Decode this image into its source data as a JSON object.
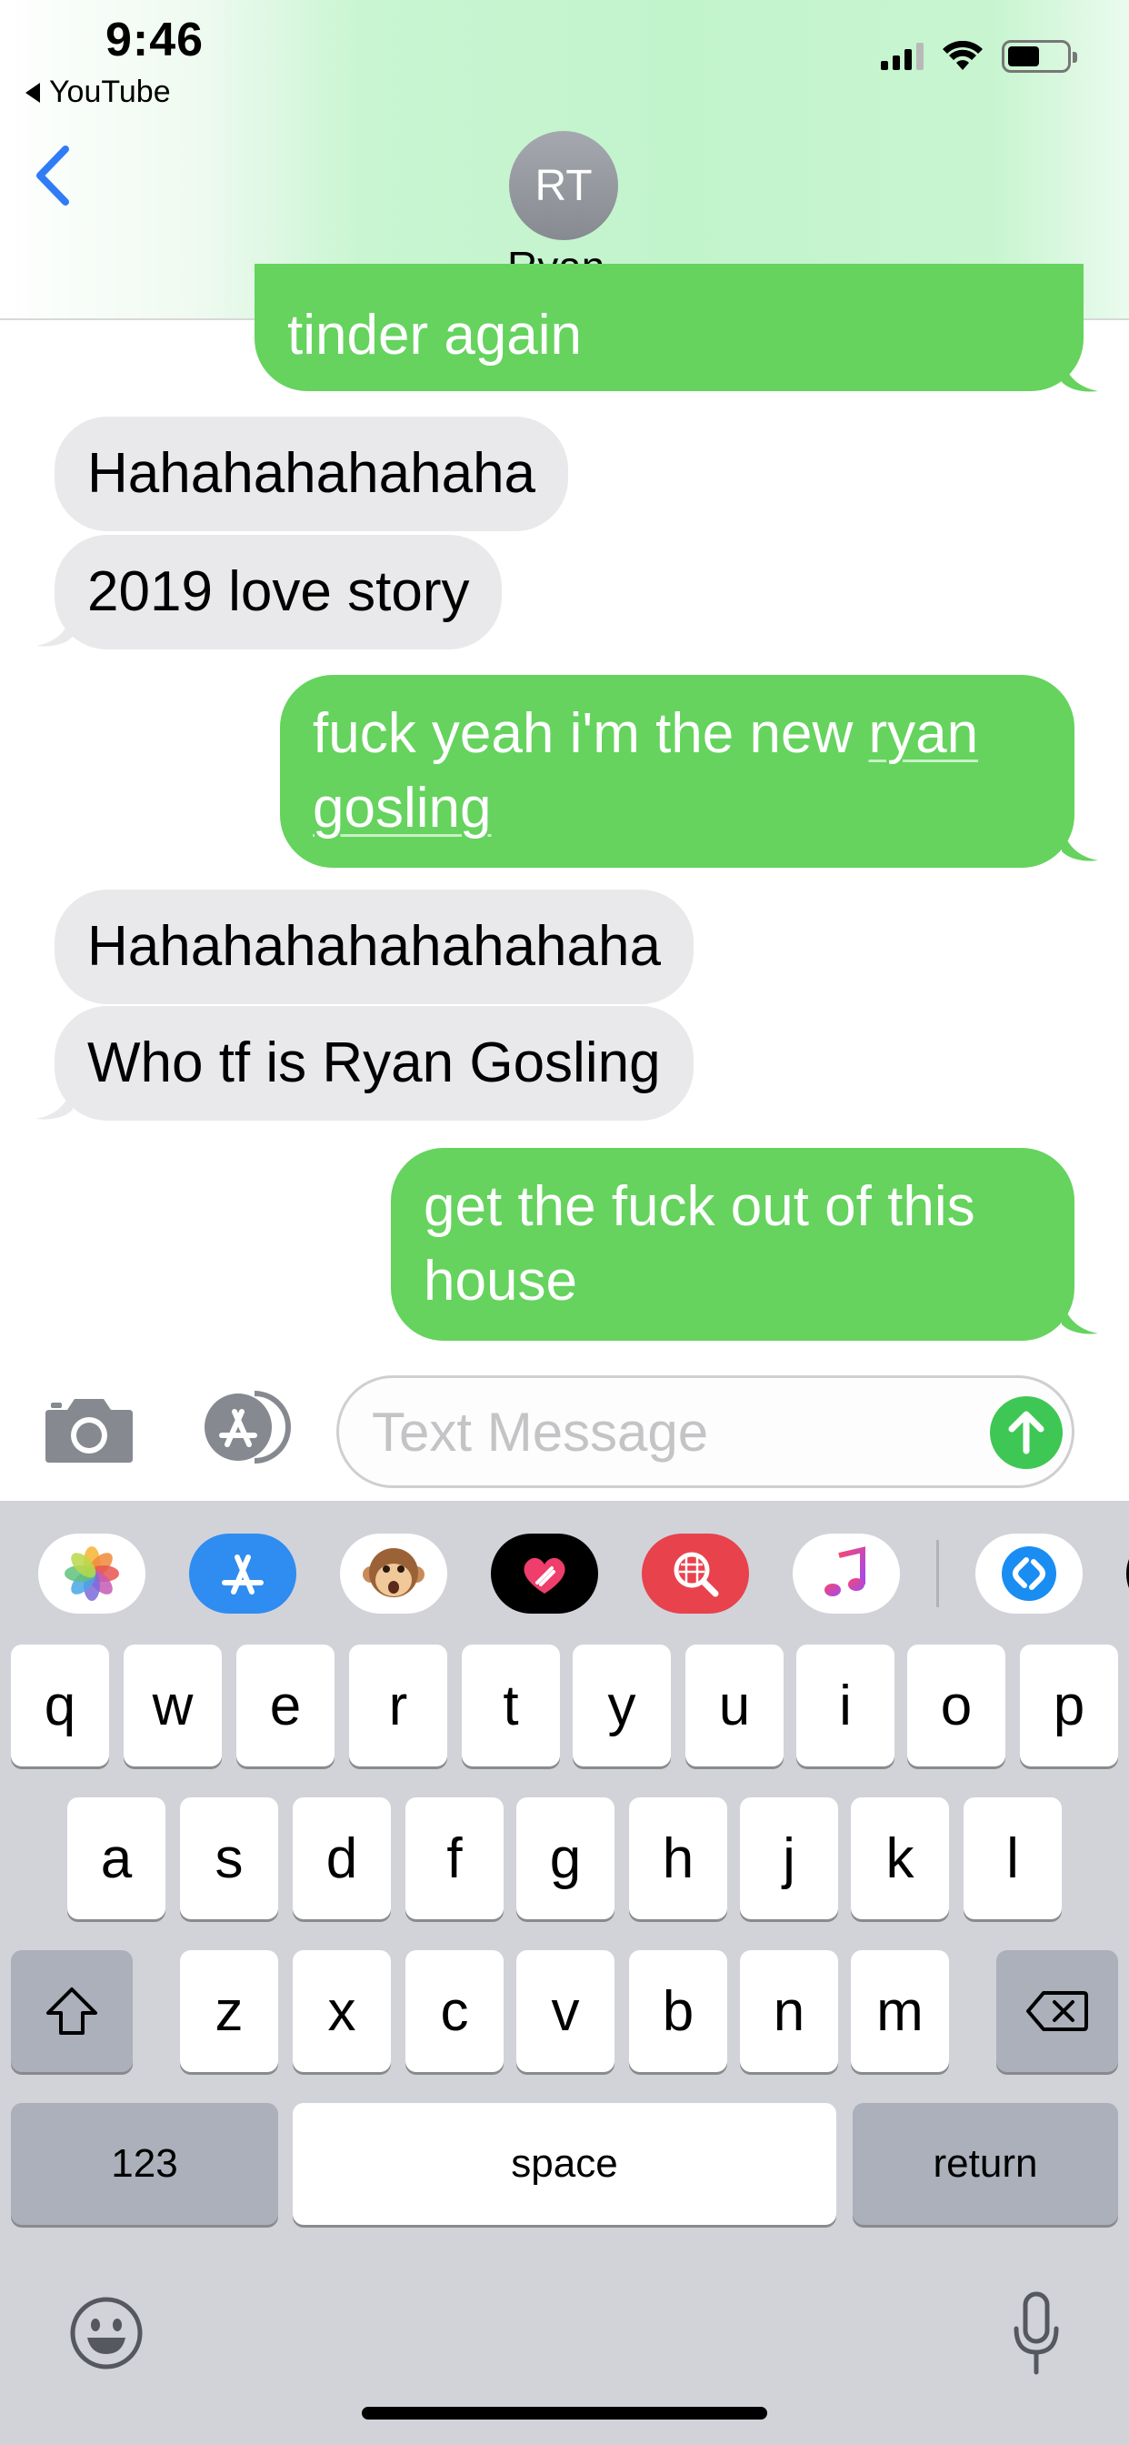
{
  "status_bar": {
    "time": "9:46",
    "back_app": "YouTube"
  },
  "nav": {
    "avatar_initials": "RT",
    "contact_name": "Ryan",
    "chevron": "›"
  },
  "messages": [
    {
      "direction": "sent",
      "text": "tinder again"
    },
    {
      "direction": "received",
      "text": "Hahahahahahaha"
    },
    {
      "direction": "received",
      "text": "2019 love story"
    },
    {
      "direction": "sent",
      "text_plain": "fuck yeah i'm the new ",
      "text_link_1": "ryan",
      "text_link_2": "gosling"
    },
    {
      "direction": "received",
      "text": "Hahahahahahahahaha"
    },
    {
      "direction": "received",
      "text": "Who tf is Ryan Gosling"
    },
    {
      "direction": "sent",
      "line1": "get the fuck out of this",
      "line2": "house"
    }
  ],
  "input": {
    "placeholder": "Text Message"
  },
  "app_drawer": [
    {
      "name": "photos-icon"
    },
    {
      "name": "app-store-icon"
    },
    {
      "name": "animoji-icon"
    },
    {
      "name": "digital-touch-icon"
    },
    {
      "name": "image-search-icon"
    },
    {
      "name": "music-icon"
    },
    {
      "name": "shazam-icon"
    }
  ],
  "keyboard": {
    "row1": [
      "q",
      "w",
      "e",
      "r",
      "t",
      "y",
      "u",
      "i",
      "o",
      "p"
    ],
    "row2": [
      "a",
      "s",
      "d",
      "f",
      "g",
      "h",
      "j",
      "k",
      "l"
    ],
    "row3": [
      "z",
      "x",
      "c",
      "v",
      "b",
      "n",
      "m"
    ],
    "numbers_label": "123",
    "space_label": "space",
    "return_label": "return"
  },
  "colors": {
    "sent_bubble": "#65d35e",
    "received_bubble": "#e9e9eb",
    "ios_blue": "#2f7cf6",
    "send_button": "#3ec754"
  }
}
